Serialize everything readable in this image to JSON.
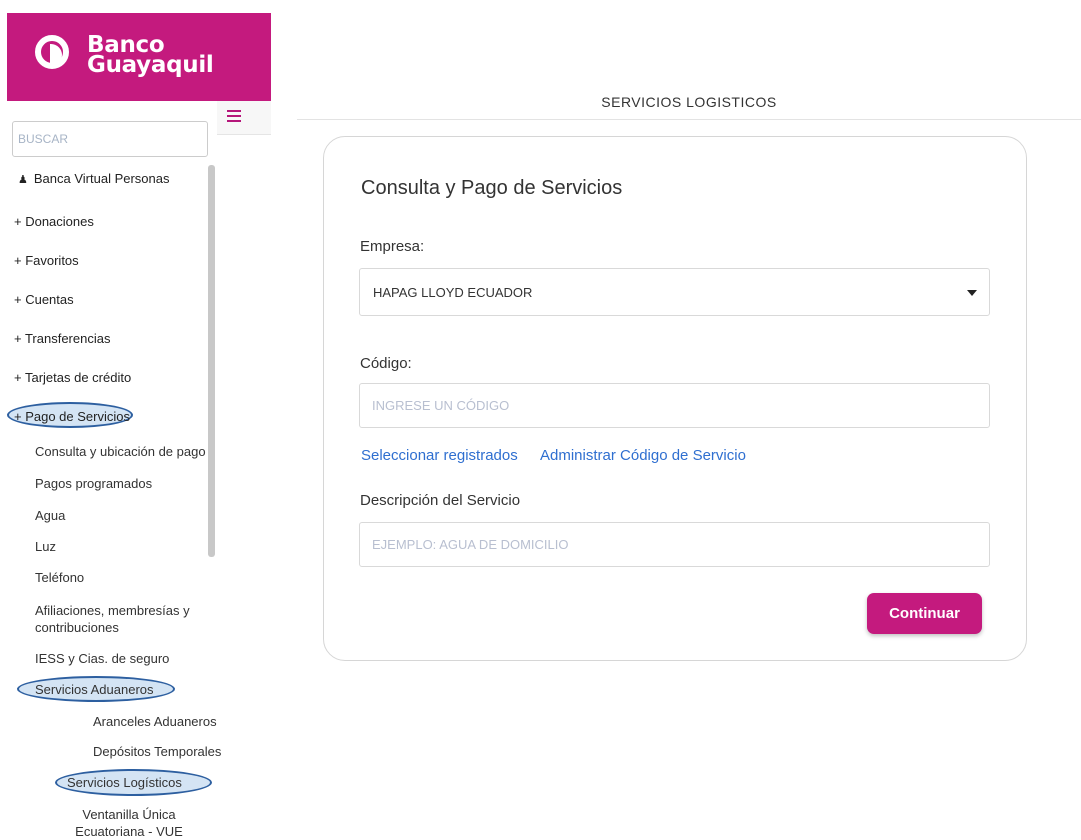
{
  "brand": {
    "line1": "Banco",
    "line2": "Guayaquil",
    "color": "#c41a7e"
  },
  "sidebar": {
    "search_placeholder": "BUSCAR",
    "user_label": "Banca Virtual Personas",
    "items": [
      {
        "label": "+ Donaciones"
      },
      {
        "label": "+ Favoritos"
      },
      {
        "label": "+ Cuentas"
      },
      {
        "label": "+ Transferencias"
      },
      {
        "label": "+ Tarjetas de crédito"
      },
      {
        "label": "+ Pago de Servicios"
      }
    ],
    "sub_items": [
      {
        "label": "Consulta y ubicación de pago"
      },
      {
        "label": "Pagos programados"
      },
      {
        "label": "Agua"
      },
      {
        "label": "Luz"
      },
      {
        "label": "Teléfono"
      },
      {
        "label": "Afiliaciones, membresías y contribuciones"
      },
      {
        "label": "IESS y Cias. de seguro"
      },
      {
        "label": "Servicios Aduaneros"
      }
    ],
    "aduaneros_items": [
      {
        "label": "Aranceles Aduaneros"
      },
      {
        "label": "Depósitos Temporales"
      },
      {
        "label": "Servicios Logísticos"
      },
      {
        "label": "Ventanilla Única Ecuatoriana - VUE"
      }
    ]
  },
  "main": {
    "header": "SERVICIOS LOGISTICOS",
    "card_title": "Consulta y Pago de Servicios",
    "empresa_label": "Empresa:",
    "empresa_value": "HAPAG LLOYD ECUADOR",
    "codigo_label": "Código:",
    "codigo_placeholder": "INGRESE UN CÓDIGO",
    "link_registrados": "Seleccionar registrados",
    "link_administrar": "Administrar Código de Servicio",
    "descripcion_label": "Descripción del Servicio",
    "descripcion_placeholder": "EJEMPLO: AGUA DE DOMICILIO",
    "continuar_label": "Continuar"
  }
}
